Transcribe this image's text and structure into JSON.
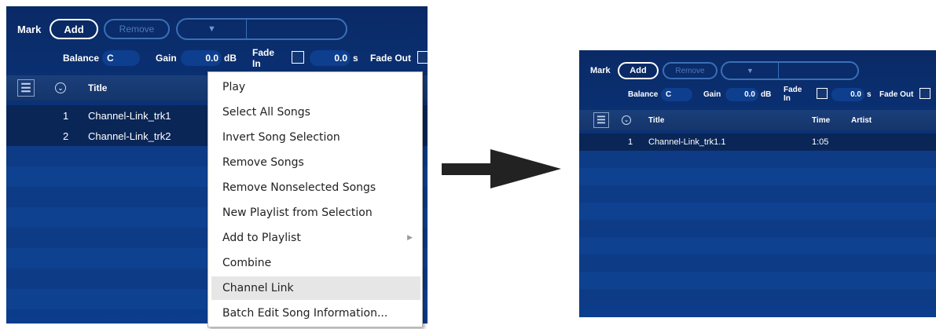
{
  "left": {
    "toolbar": {
      "mark_label": "Mark",
      "add_label": "Add",
      "remove_label": "Remove",
      "combo_arrow": "▼"
    },
    "controls": {
      "balance_label": "Balance",
      "balance_value": "C",
      "gain_label": "Gain",
      "gain_value": "0.0",
      "gain_unit": "dB",
      "fade_in_label": "Fade In",
      "fade_in_value": "0.0",
      "fade_in_unit": "s",
      "fade_out_label": "Fade Out"
    },
    "header": {
      "title_col": "Title"
    },
    "rows": [
      {
        "num": "1",
        "title": "Channel-Link_trk1"
      },
      {
        "num": "2",
        "title": "Channel-Link_trk2"
      }
    ]
  },
  "menu": {
    "items": [
      {
        "label": "Play"
      },
      {
        "label": "Select All Songs"
      },
      {
        "label": "Invert Song Selection"
      },
      {
        "label": "Remove Songs"
      },
      {
        "label": "Remove Nonselected Songs"
      },
      {
        "label": "New Playlist from Selection"
      },
      {
        "label": "Add to Playlist"
      },
      {
        "label": "Combine"
      },
      {
        "label": "Channel Link"
      },
      {
        "label": "Batch Edit Song Information..."
      }
    ],
    "submenu_arrow": "▶"
  },
  "right": {
    "toolbar": {
      "mark_label": "Mark",
      "add_label": "Add",
      "remove_label": "Remove",
      "combo_arrow": "▼"
    },
    "controls": {
      "balance_label": "Balance",
      "balance_value": "C",
      "gain_label": "Gain",
      "gain_value": "0.0",
      "gain_unit": "dB",
      "fade_in_label": "Fade In",
      "fade_in_value": "0.0",
      "fade_in_unit": "s",
      "fade_out_label": "Fade Out"
    },
    "header": {
      "title_col": "Title",
      "time_col": "Time",
      "artist_col": "Artist"
    },
    "rows": [
      {
        "num": "1",
        "title": "Channel-Link_trk1.1",
        "time": "1:05"
      }
    ]
  }
}
